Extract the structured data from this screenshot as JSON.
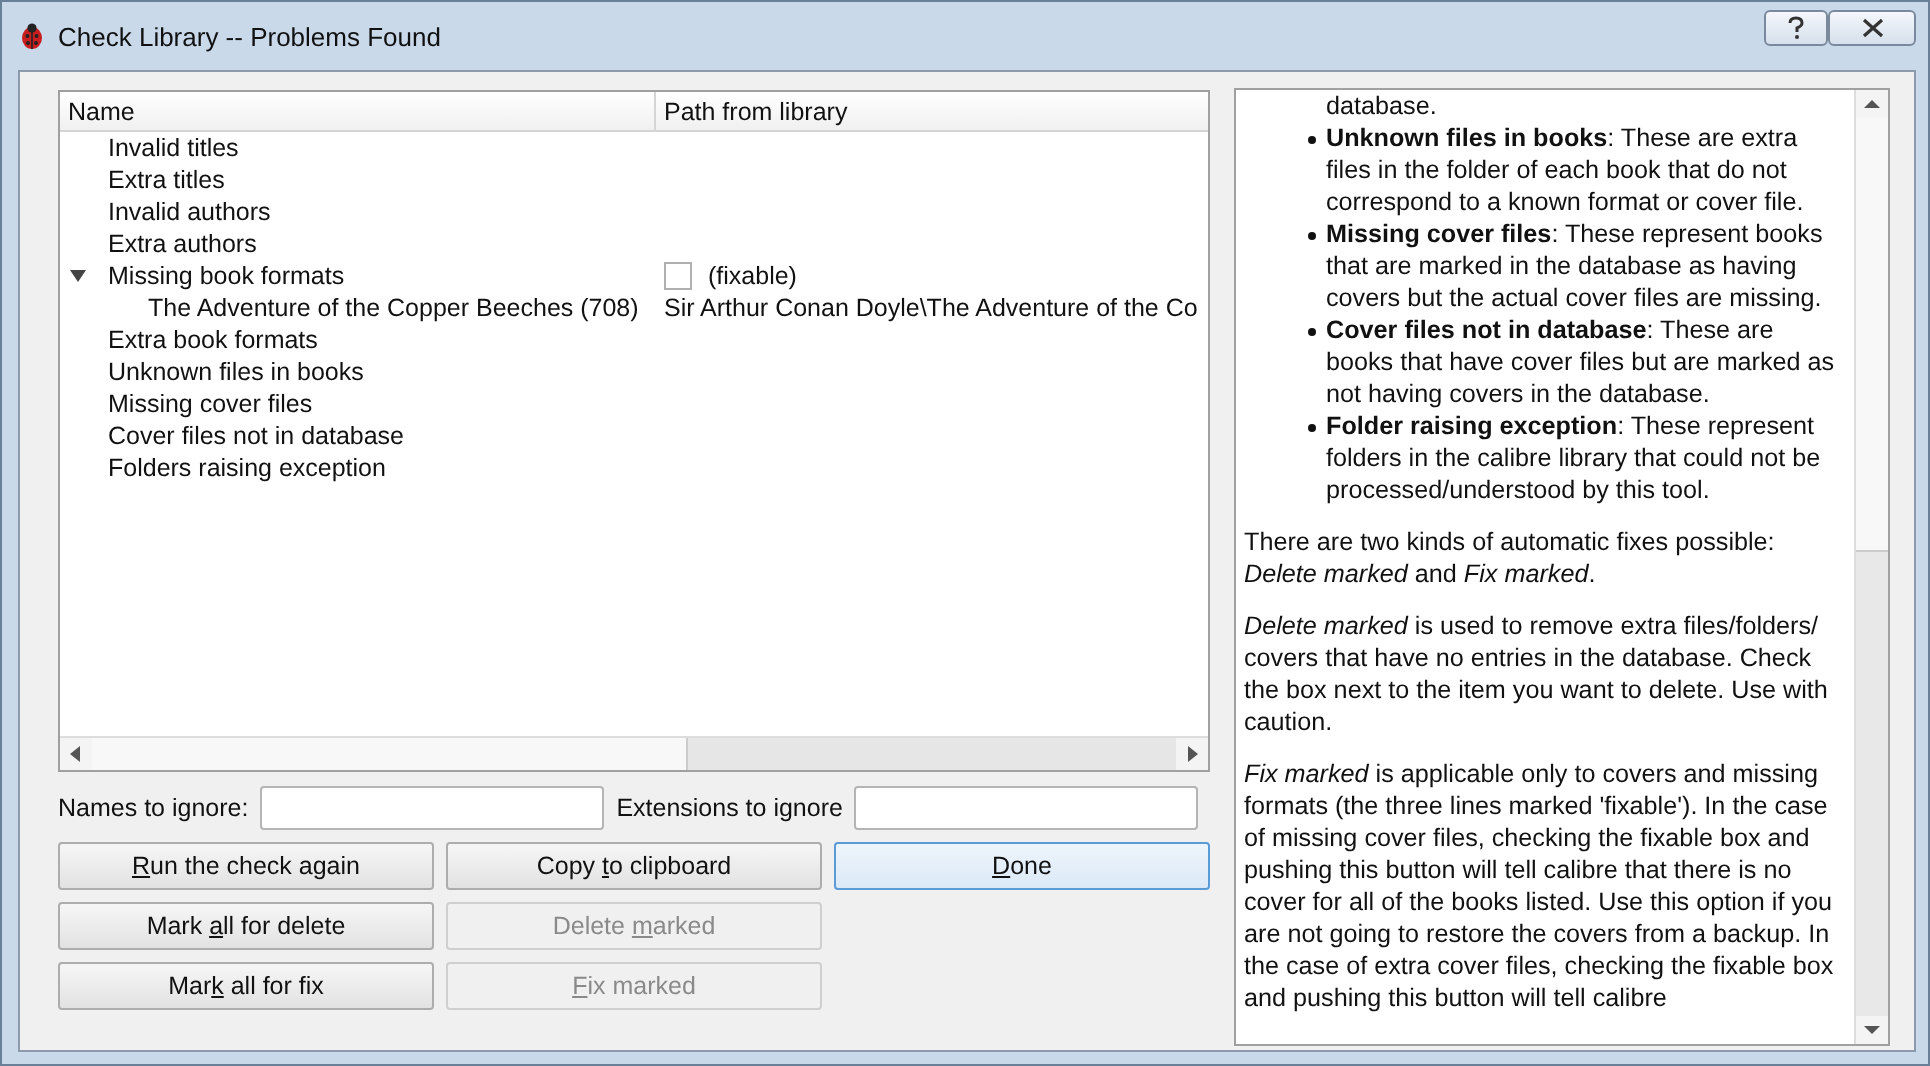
{
  "window": {
    "title": "Check Library -- Problems Found"
  },
  "tree": {
    "columns": [
      "Name",
      "Path from library"
    ],
    "rows": [
      {
        "name": "Invalid titles"
      },
      {
        "name": "Extra titles"
      },
      {
        "name": "Invalid authors"
      },
      {
        "name": "Extra authors"
      },
      {
        "name": "Missing book formats",
        "expanded": true,
        "checkbox": {
          "checked": false
        },
        "path": "(fixable)",
        "children": [
          {
            "name": "The Adventure of the Copper Beeches (708)",
            "path": "Sir Arthur Conan Doyle\\The Adventure of the Co"
          }
        ]
      },
      {
        "name": "Extra book formats"
      },
      {
        "name": "Unknown files in books"
      },
      {
        "name": "Missing cover files"
      },
      {
        "name": "Cover files not in database"
      },
      {
        "name": "Folders raising exception"
      }
    ]
  },
  "fields": [
    {
      "label": "Names to ignore:"
    },
    {
      "label": "Extensions to ignore"
    }
  ],
  "button_rows": [
    [
      {
        "label": {
          "key": "R",
          "after": "un the check again"
        },
        "disabled": false,
        "focused": false
      },
      {
        "label": {
          "before": "Copy ",
          "key": "t",
          "after": "o clipboard"
        },
        "disabled": false,
        "focused": false
      },
      {
        "label": {
          "key": "D",
          "after": "one"
        },
        "disabled": false,
        "focused": true
      }
    ],
    [
      {
        "label": {
          "before": "Mark ",
          "key": "a",
          "after": "ll for delete"
        },
        "disabled": false,
        "focused": false
      },
      {
        "label": {
          "before": "Delete ",
          "key": "m",
          "after": "arked"
        },
        "disabled": true,
        "focused": false
      }
    ],
    [
      {
        "label": {
          "before": "Mar",
          "key": "k",
          "after": " all for fix"
        },
        "disabled": false,
        "focused": false
      },
      {
        "label": {
          "key": "F",
          "after": "ix marked"
        },
        "disabled": true,
        "focused": false
      }
    ]
  ],
  "help": [
    {
      "kind": "continuation",
      "text": "database."
    },
    {
      "kind": "bullet",
      "text": "**Unknown files in books**: These are extra files in the folder of each book that do not correspond to a known format or cover file."
    },
    {
      "kind": "bullet",
      "text": "**Missing cover files**: These represent books that are marked in the database as having covers but the actual cover files are missing."
    },
    {
      "kind": "bullet",
      "text": "**Cover files not in database**: These are books that have cover files but are marked as not having covers in the database."
    },
    {
      "kind": "bullet",
      "text": "**Folder raising exception**: These represent folders in the calibre library that could not be processed/understood by this tool."
    },
    {
      "kind": "para",
      "text": "There are two kinds of automatic fixes possible: *Delete marked* and *Fix marked*."
    },
    {
      "kind": "para",
      "text": "*Delete marked* is used to remove extra files/folders/ covers that have no entries in the database. Check the box next to the item you want to delete. Use with caution."
    },
    {
      "kind": "para",
      "text": "*Fix marked* is applicable only to covers and missing formats (the three lines marked 'fixable'). In the case of missing cover files, checking the fixable box and pushing this button will tell calibre that there is no cover for all of the books listed. Use this option if you are not going to restore the covers from a backup. In the case of extra cover files, checking the fixable box and pushing this button will tell calibre"
    }
  ]
}
